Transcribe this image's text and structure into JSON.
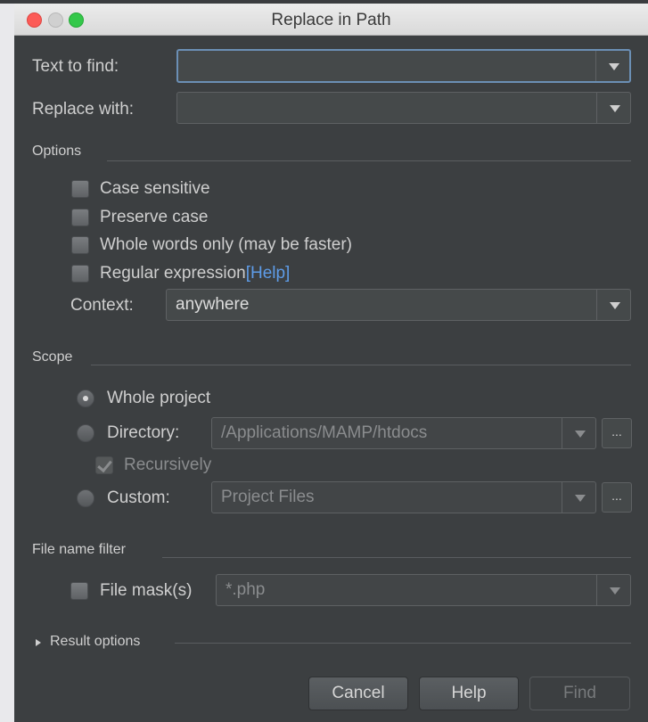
{
  "window": {
    "title": "Replace in Path"
  },
  "find": {
    "label": "Text to find:",
    "value": ""
  },
  "replace": {
    "label": "Replace with:",
    "value": ""
  },
  "options": {
    "title": "Options",
    "case_sensitive": "Case sensitive",
    "preserve_case": "Preserve case",
    "whole_words": "Whole words only (may be faster)",
    "regex": "Regular expression",
    "regex_help": "[Help]",
    "context_label": "Context:",
    "context_value": "anywhere"
  },
  "scope": {
    "title": "Scope",
    "whole_project": "Whole project",
    "directory_label": "Directory:",
    "directory_value": "/Applications/MAMP/htdocs",
    "recursively": "Recursively",
    "custom_label": "Custom:",
    "custom_value": "Project Files",
    "ellipsis": "..."
  },
  "filter": {
    "title": "File name filter",
    "mask_label": "File mask(s)",
    "mask_value": "*.php"
  },
  "result_options": "Result options",
  "buttons": {
    "cancel": "Cancel",
    "help": "Help",
    "find": "Find"
  }
}
